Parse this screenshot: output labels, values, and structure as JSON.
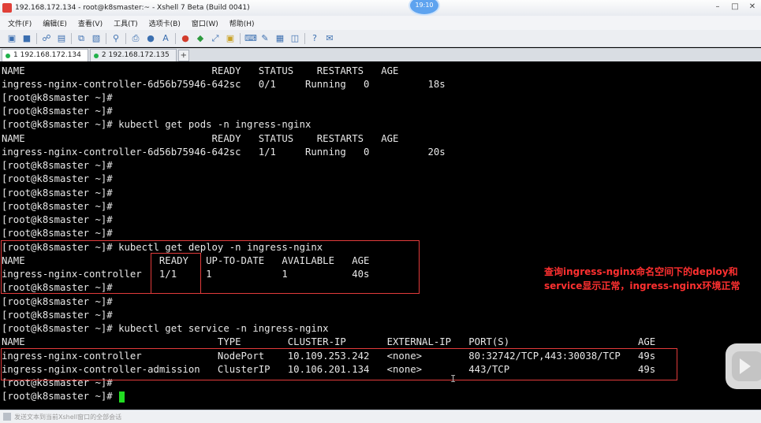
{
  "window": {
    "title": "192.168.172.134 - root@k8smaster:~ - Xshell 7 Beta (Build 0041)",
    "clock": "19:10"
  },
  "menu": [
    "文件(F)",
    "编辑(E)",
    "查看(V)",
    "工具(T)",
    "选项卡(B)",
    "窗口(W)",
    "帮助(H)"
  ],
  "tabs": [
    {
      "label": "1 192.168.172.134",
      "active": true
    },
    {
      "label": "2 192.168.172.135",
      "active": false
    }
  ],
  "terminal": {
    "lines": [
      "NAME                                READY   STATUS    RESTARTS   AGE",
      "ingress-nginx-controller-6d56b75946-642sc   0/1     Running   0          18s",
      "[root@k8smaster ~]#",
      "[root@k8smaster ~]#",
      "[root@k8smaster ~]# kubectl get pods -n ingress-nginx",
      "NAME                                READY   STATUS    RESTARTS   AGE",
      "ingress-nginx-controller-6d56b75946-642sc   1/1     Running   0          20s",
      "[root@k8smaster ~]#",
      "[root@k8smaster ~]#",
      "[root@k8smaster ~]#",
      "[root@k8smaster ~]#",
      "[root@k8smaster ~]#",
      "[root@k8smaster ~]#",
      "[root@k8smaster ~]# kubectl get deploy -n ingress-nginx",
      "NAME                       READY   UP-TO-DATE   AVAILABLE   AGE",
      "ingress-nginx-controller   1/1     1            1           40s",
      "[root@k8smaster ~]#",
      "[root@k8smaster ~]#",
      "[root@k8smaster ~]#",
      "[root@k8smaster ~]# kubectl get service -n ingress-nginx",
      "NAME                                 TYPE        CLUSTER-IP       EXTERNAL-IP   PORT(S)                      AGE",
      "ingress-nginx-controller             NodePort    10.109.253.242   <none>        80:32742/TCP,443:30038/TCP   49s",
      "ingress-nginx-controller-admission   ClusterIP   10.106.201.134   <none>        443/TCP                      49s",
      "[root@k8smaster ~]#",
      "[root@k8smaster ~]# "
    ]
  },
  "annotation": "查询ingress-nginx命名空间下的deploy和service显示正常，ingress-nginx环境正常",
  "status_text": "发送文本到当前Xshell窗口的全部会话",
  "colors": {
    "cursor": "#22dd22",
    "highlight": "#e23b3b",
    "annotation": "#ff3030"
  }
}
